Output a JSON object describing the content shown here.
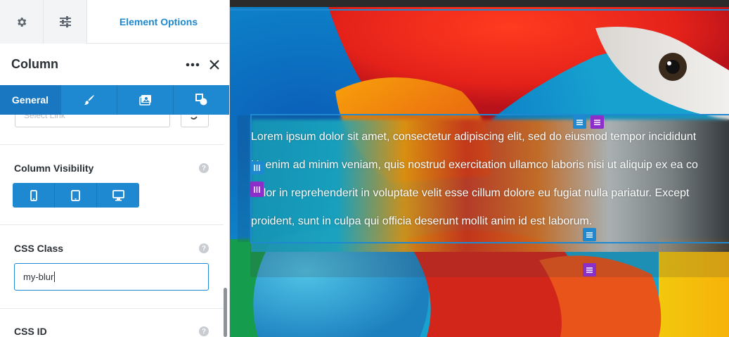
{
  "topbar": {
    "settings_icon": "gear-icon",
    "options_icon": "sliders-icon",
    "title": "Element Options"
  },
  "header": {
    "title": "Column",
    "more_icon": "more-horizontal-icon",
    "close_icon": "close-icon"
  },
  "tabs": [
    {
      "label": "General",
      "active": true
    },
    {
      "icon": "brush-icon"
    },
    {
      "icon": "media-icon"
    },
    {
      "icon": "shapes-icon"
    }
  ],
  "link": {
    "placeholder": "Select Link"
  },
  "visibility": {
    "label": "Column Visibility",
    "devices": [
      "mobile-icon",
      "tablet-icon",
      "desktop-icon"
    ]
  },
  "css_class": {
    "label": "CSS Class",
    "value": "my-blur"
  },
  "css_id": {
    "label": "CSS ID"
  },
  "canvas": {
    "lines": [
      "Lorem ipsum dolor sit amet, consectetur adipiscing elit, sed do eiusmod tempor incididunt",
      "Ut enim ad minim veniam, quis nostrud exercitation ullamco laboris nisi ut aliquip ex ea co",
      "dolor in reprehenderit in voluptate velit esse cillum dolore eu fugiat nulla pariatur. Except",
      "proident, sunt in culpa qui officia deserunt mollit anim id est laborum."
    ]
  },
  "colors": {
    "accent": "#1e88d0",
    "purple": "#8b2fc9"
  }
}
